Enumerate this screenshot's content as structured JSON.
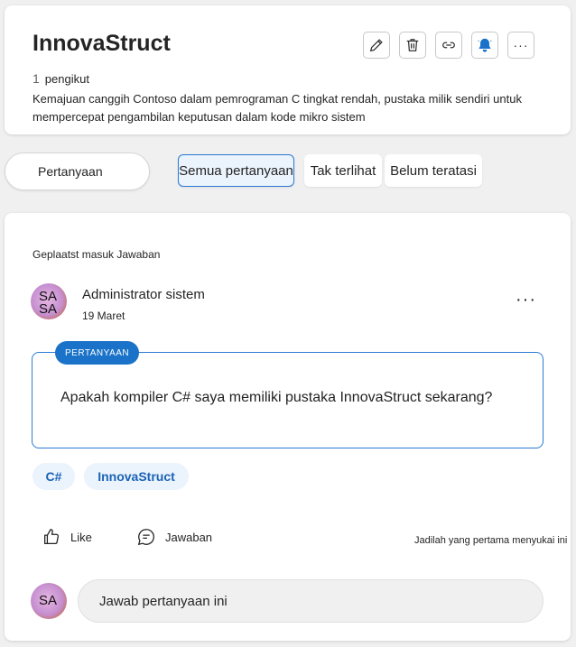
{
  "header": {
    "title": "InnovaStruct",
    "follower_count": "1",
    "follower_label": "pengikut",
    "description": "Kemajuan canggih Contoso dalam pemrograman C tingkat rendah, pustaka milik sendiri untuk mempercepat pengambilan keputusan dalam kode mikro sistem",
    "actions": [
      {
        "icon": "pencil-icon"
      },
      {
        "icon": "trash-icon"
      },
      {
        "icon": "link-icon"
      },
      {
        "icon": "bell-icon",
        "color": "#1a73c8"
      },
      {
        "icon": "more-horizontal-icon",
        "text": "···"
      }
    ]
  },
  "filters": {
    "search_label": "Pertanyaan",
    "tabs": [
      {
        "label": "Semua pertanyaan",
        "selected": true
      },
      {
        "label": "Tak terlihat",
        "selected": false
      },
      {
        "label": "Belum teratasi",
        "selected": false
      }
    ]
  },
  "post": {
    "context": "Geplaatst masuk Jawaban",
    "author": {
      "initials": "SA\nSA",
      "name": "Administrator sistem"
    },
    "date": "19 Maret",
    "more": "···",
    "badge": "PERTANYAAN",
    "question": "Apakah kompiler C# saya memiliki pustaka InnovaStruct sekarang?",
    "tags": [
      "C#",
      "InnovaStruct"
    ],
    "actions": {
      "like": "Like",
      "reply": "Jawaban"
    },
    "first_like_note": "Jadilah yang pertama menyukai ini"
  },
  "reply": {
    "avatar_initials": "SA",
    "placeholder": "Jawab pertanyaan ini"
  },
  "colors": {
    "accent": "#1a73c8",
    "tag_bg": "#ebf3fc",
    "page_bg": "#f0f0f0"
  }
}
